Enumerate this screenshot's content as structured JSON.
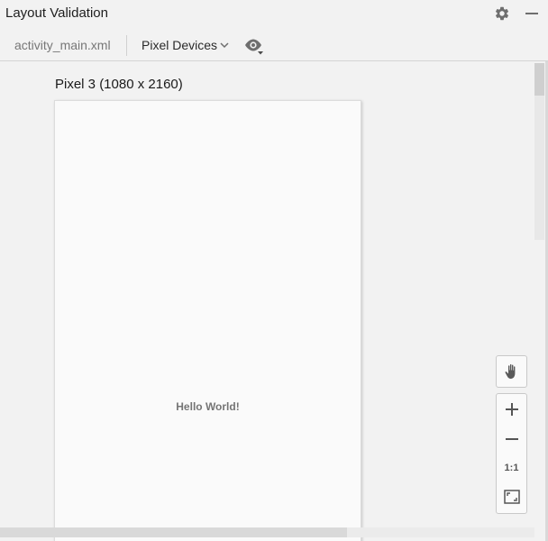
{
  "window": {
    "title": "Layout Validation",
    "settings_icon": "gear-icon",
    "minimize_icon": "minimize-icon"
  },
  "toolbar": {
    "file_name": "activity_main.xml",
    "device_selector": "Pixel Devices",
    "dropdown_icon": "chevron-down-icon",
    "visibility_icon": "eye-icon"
  },
  "canvas": {
    "device_label": "Pixel 3 (1080 x 2160)",
    "preview_text": "Hello World!"
  },
  "zoom_controls": {
    "pan_icon": "hand-icon",
    "zoom_in_icon": "plus-icon",
    "zoom_out_icon": "minus-icon",
    "actual_size_label": "1:1",
    "fit_icon": "fit-screen-icon"
  },
  "colors": {
    "background": "#f2f2f2",
    "device_surface": "#fafafa",
    "icon": "#6e6e6e"
  }
}
